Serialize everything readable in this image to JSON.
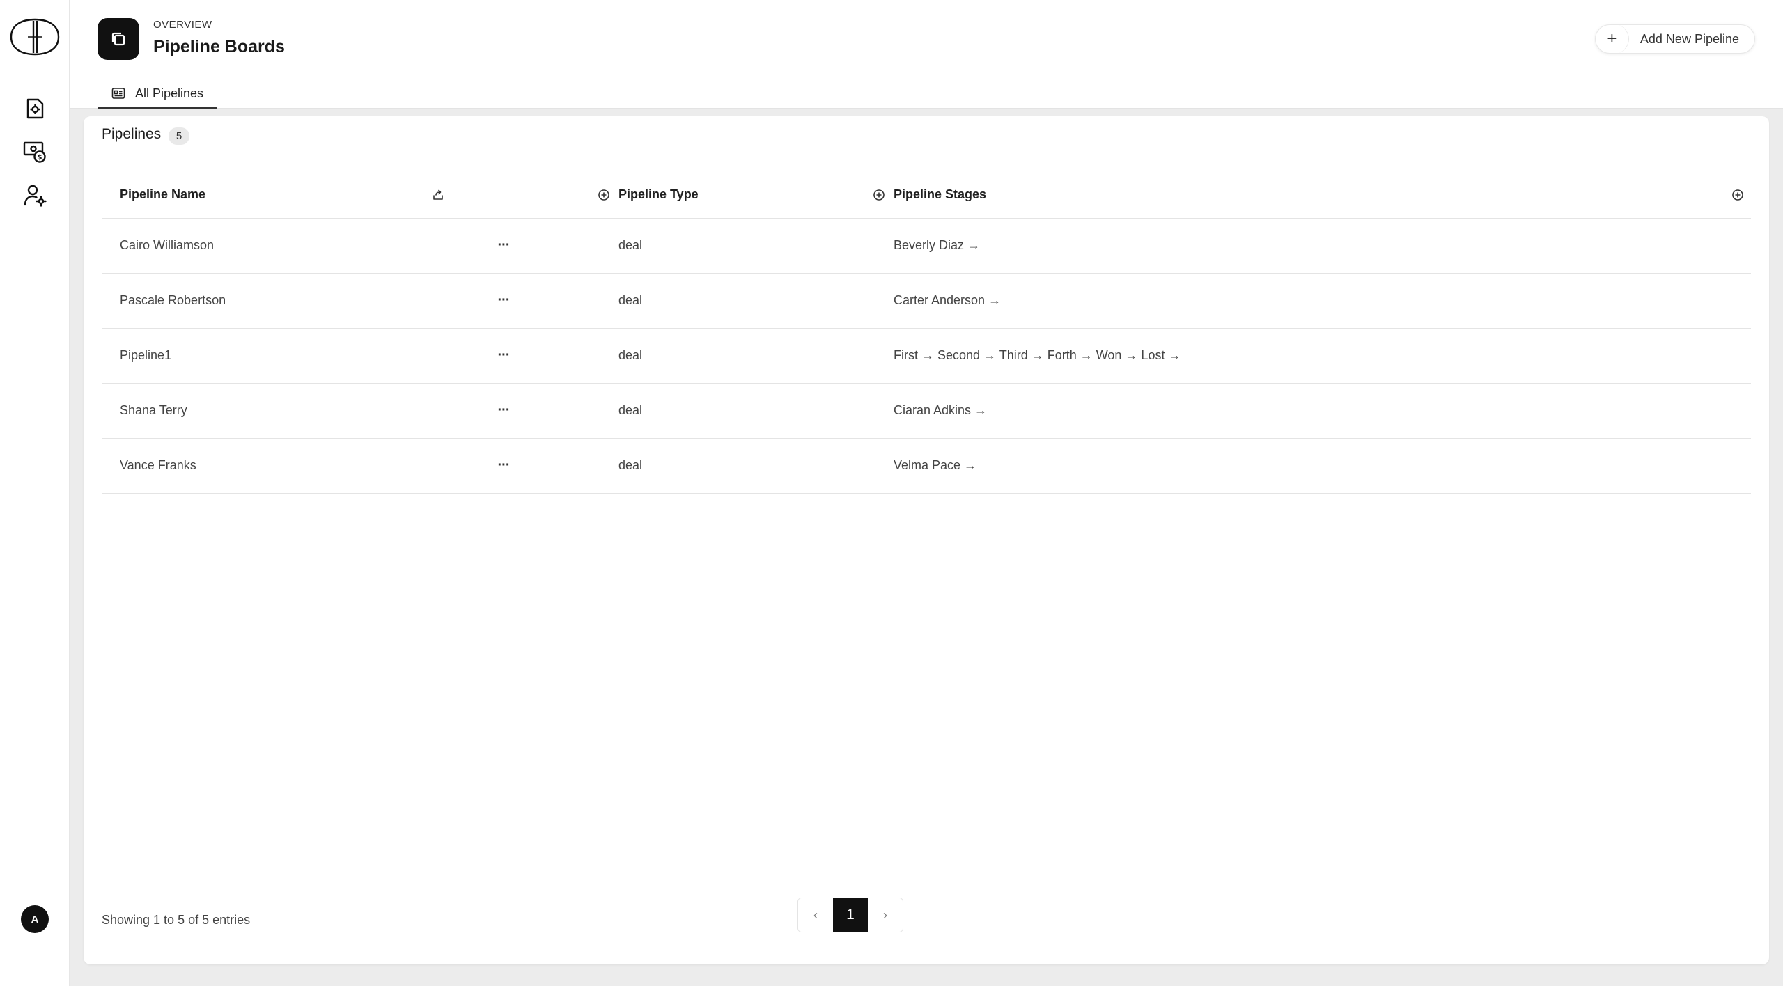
{
  "header": {
    "overline": "OVERVIEW",
    "title": "Pipeline Boards",
    "add_button_label": "Add New Pipeline",
    "add_button_icon": "+"
  },
  "tabs": [
    {
      "label": "All Pipelines",
      "icon": "id-card-icon",
      "active": true
    }
  ],
  "user": {
    "avatar_initial": "A"
  },
  "card": {
    "title": "Pipelines",
    "count": "5"
  },
  "table": {
    "columns": {
      "name": "Pipeline Name",
      "type": "Pipeline Type",
      "stages": "Pipeline Stages"
    },
    "row_action_label": "···",
    "rows": [
      {
        "name": "Cairo Williamson",
        "type": "deal",
        "stages": "Beverly Diaz →"
      },
      {
        "name": "Pascale Robertson",
        "type": "deal",
        "stages": "Carter Anderson →"
      },
      {
        "name": "Pipeline1",
        "type": "deal",
        "stages": "First → Second → Third → Forth → Won → Lost →"
      },
      {
        "name": "Shana Terry",
        "type": "deal",
        "stages": "Ciaran Adkins →"
      },
      {
        "name": "Vance Franks",
        "type": "deal",
        "stages": "Velma Pace →"
      }
    ]
  },
  "footer": {
    "summary": "Showing 1 to 5 of 5 entries",
    "pagination": {
      "prev": "‹",
      "current": "1",
      "next": "›"
    }
  },
  "colors": {
    "accent": "#111111",
    "background": "#ececec",
    "card": "#ffffff"
  }
}
